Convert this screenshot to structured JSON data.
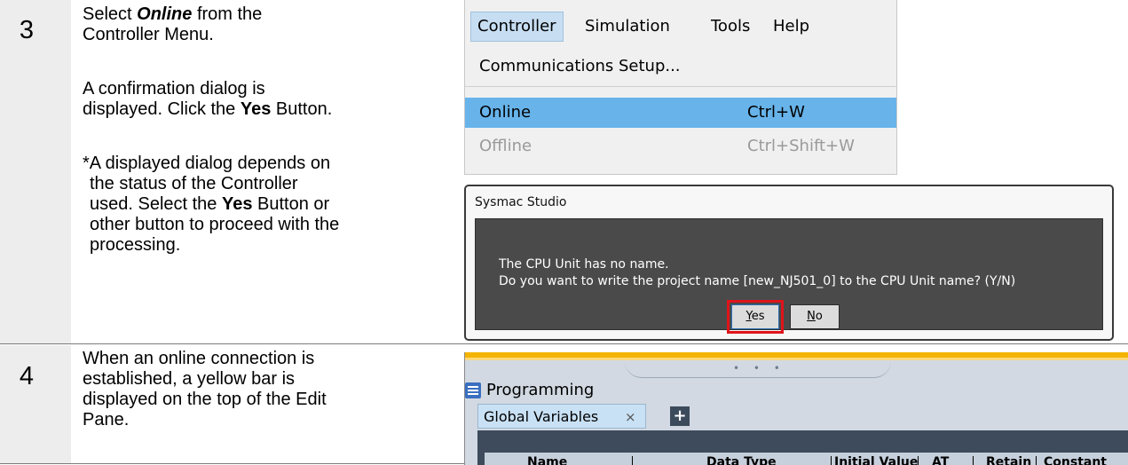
{
  "step3": {
    "number": "3",
    "line1_prefix": "Select ",
    "line1_em": "Online",
    "line1_suffix": " from the",
    "line2": "Controller Menu.",
    "para2_a": "A confirmation dialog is",
    "para2_b_prefix": "displayed. Click the ",
    "para2_b_bold": "Yes",
    "para2_b_suffix": " Button.",
    "note_l1": "*A displayed dialog depends on",
    "note_l2": "the status of the Controller",
    "note_l3_prefix": "used. Select the ",
    "note_l3_bold": "Yes",
    "note_l3_suffix": " Button or",
    "note_l4": "other button to proceed with the",
    "note_l5": "processing."
  },
  "step4": {
    "number": "4",
    "l1": "When an online connection is",
    "l2": "established, a yellow bar is",
    "l3": "displayed on the top of the Edit",
    "l4": "Pane."
  },
  "menu": {
    "bar": [
      "Controller",
      "Simulation",
      "Tools",
      "Help"
    ],
    "items": [
      {
        "label": "Communications Setup...",
        "shortcut": ""
      },
      {
        "label": "Online",
        "shortcut": "Ctrl+W"
      },
      {
        "label": "Offline",
        "shortcut": "Ctrl+Shift+W"
      }
    ]
  },
  "dialog": {
    "title": "Sysmac Studio",
    "msg1": "The CPU Unit has no name.",
    "msg2": "Do you want to write the project name [new_NJ501_0] to the CPU Unit name? (Y/N)",
    "yes_rest": "es",
    "yes_key": "Y",
    "no_rest": "o",
    "no_key": "N"
  },
  "pane": {
    "title": "Programming",
    "tab": "Global Variables",
    "tab_close": "×",
    "add": "+",
    "dots": "• • •",
    "columns": [
      "Name",
      "Data Type",
      "Initial Value",
      "AT",
      "Retain",
      "Constant"
    ]
  },
  "colors": {
    "highlight": "#67b3ea",
    "online_bar": "#f4b400",
    "focus_box": "#e0141b"
  }
}
